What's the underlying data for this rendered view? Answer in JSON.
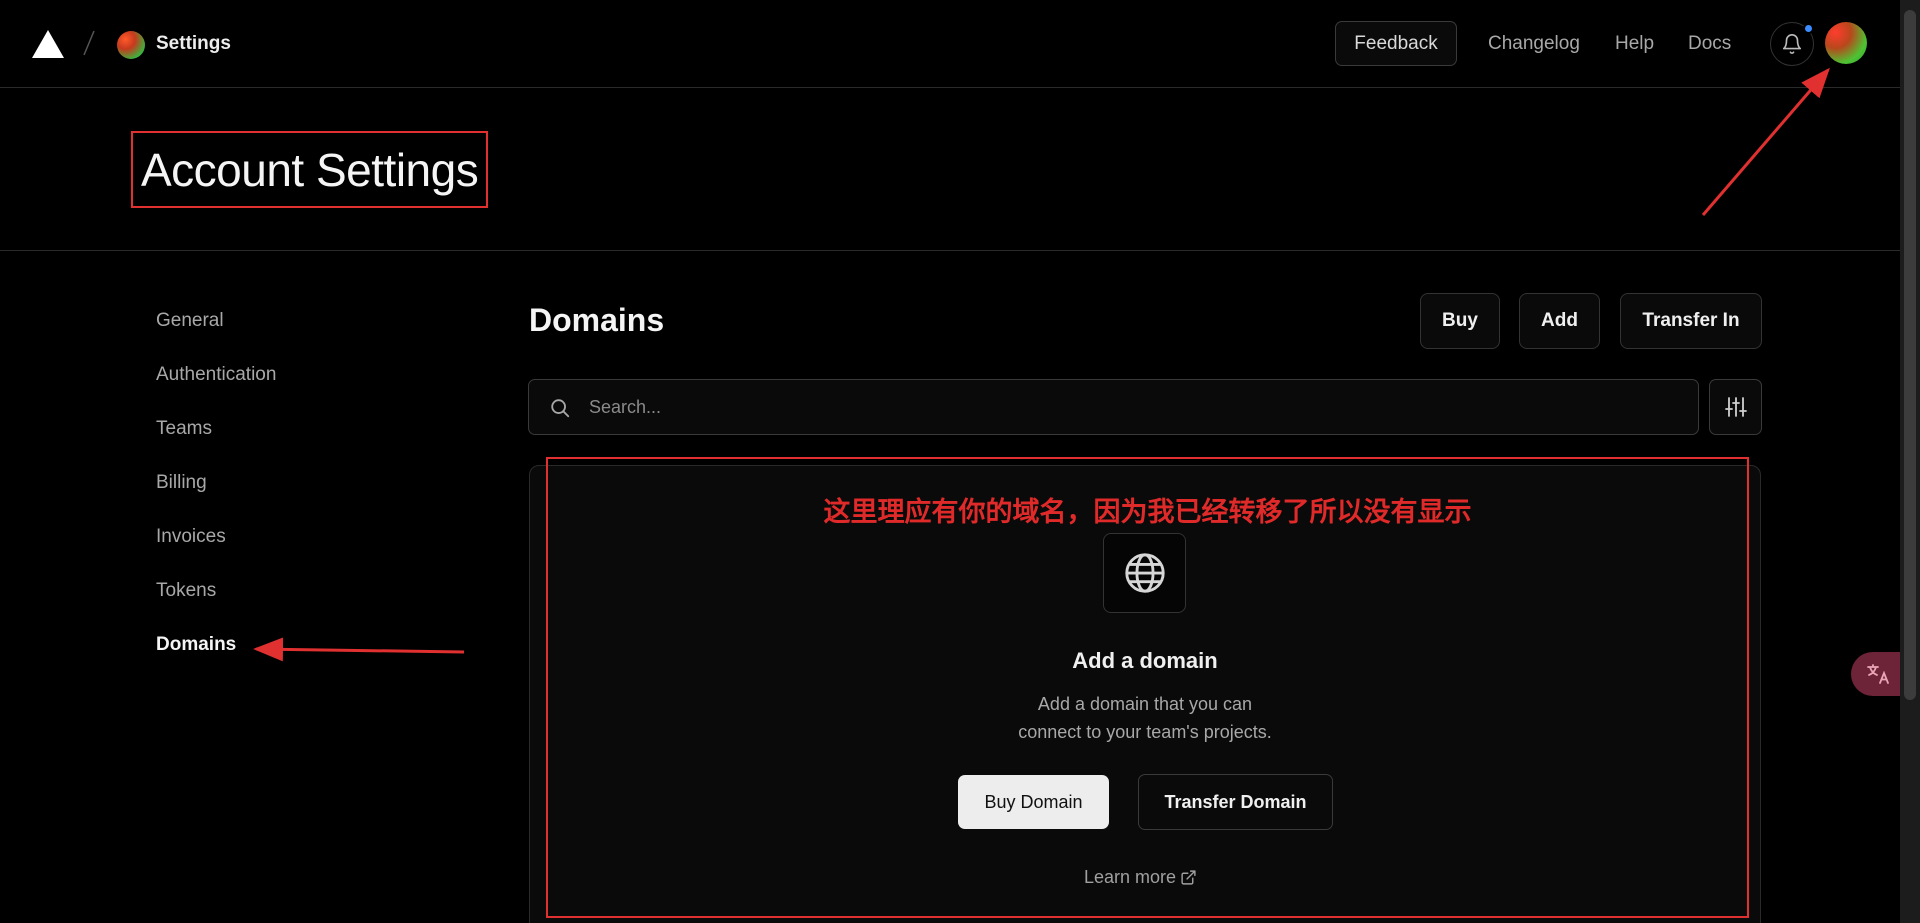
{
  "topbar": {
    "team_name": "Settings",
    "feedback_label": "Feedback",
    "links": [
      "Changelog",
      "Help",
      "Docs"
    ]
  },
  "header": {
    "title": "Account Settings"
  },
  "sidebar": {
    "items": [
      {
        "label": "General"
      },
      {
        "label": "Authentication"
      },
      {
        "label": "Teams"
      },
      {
        "label": "Billing"
      },
      {
        "label": "Invoices"
      },
      {
        "label": "Tokens"
      },
      {
        "label": "Domains",
        "active": true
      }
    ]
  },
  "domains": {
    "title": "Domains",
    "actions": [
      "Buy",
      "Add",
      "Transfer In"
    ],
    "search_placeholder": "Search...",
    "empty": {
      "title": "Add a domain",
      "desc_line1": "Add a domain that you can",
      "desc_line2": "connect to your team's projects.",
      "buy_label": "Buy Domain",
      "transfer_label": "Transfer Domain",
      "learn_more": "Learn more"
    }
  },
  "annotation": {
    "note": "这里理应有你的域名，因为我已经转移了所以没有显示",
    "color": "#e03030"
  },
  "icons": [
    "logo-triangle-icon",
    "bell-icon",
    "search-icon",
    "sliders-icon",
    "globe-icon",
    "external-link-icon",
    "translate-icon"
  ],
  "colors": {
    "background": "#000000",
    "accent_dot": "#3b8cff",
    "annotation_red": "#e03030"
  }
}
